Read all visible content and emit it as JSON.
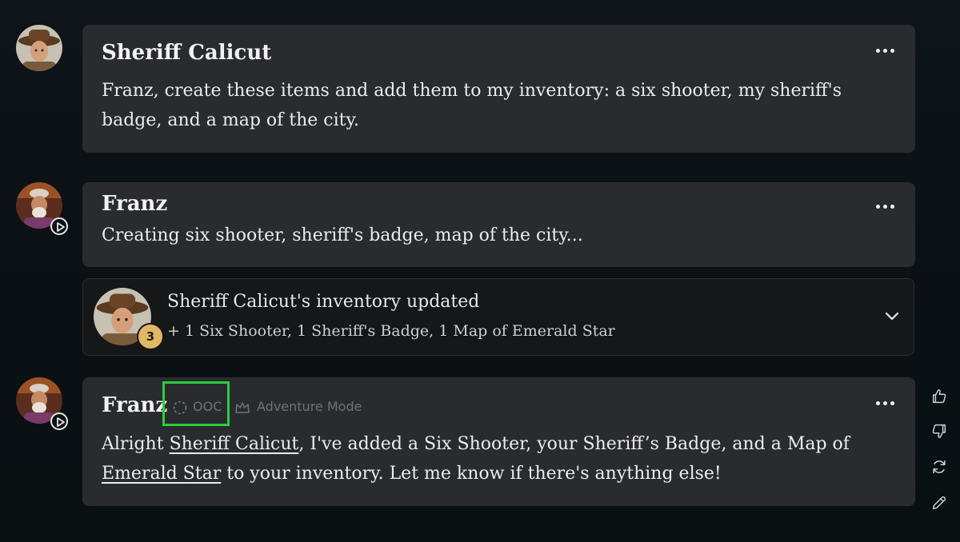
{
  "messages": [
    {
      "author": "Sheriff Calicut",
      "text_line1": "Franz, create these items and add them to my inventory: a six shooter, my sheriff's",
      "text_line2": "badge, and a map of the city."
    },
    {
      "author": "Franz",
      "text": "Creating six shooter, sheriff's badge, map of the city..."
    },
    {
      "author": "Franz",
      "ooc_label": "OOC",
      "mode_label": "Adventure Mode",
      "text_a": "Alright ",
      "link1": "Sheriff Calicut",
      "text_b": ", I've added a Six Shooter, your Sheriff’s Badge, and a Map of",
      "link2": "Emerald Star",
      "text_c": " to your inventory. Let me know if there's anything else!"
    }
  ],
  "inventory_update": {
    "title": "Sheriff Calicut's inventory updated",
    "items": "+ 1 Six Shooter, 1 Sheriff's Badge, 1 Map of Emerald Star",
    "count": "3"
  },
  "icons": {
    "more": "more-horizontal-icon",
    "chevron": "chevron-down-icon",
    "play": "play-circle-icon",
    "thumbs_up": "thumbs-up-icon",
    "thumbs_down": "thumbs-down-icon",
    "regenerate": "refresh-icon",
    "edit": "pencil-icon",
    "ooc": "dashed-circle-icon",
    "mode": "crown-icon"
  },
  "colors": {
    "card": "#2a2b2e",
    "inventory_card": "#151719",
    "highlight": "#2ecc40",
    "badge": "#e0b866"
  }
}
